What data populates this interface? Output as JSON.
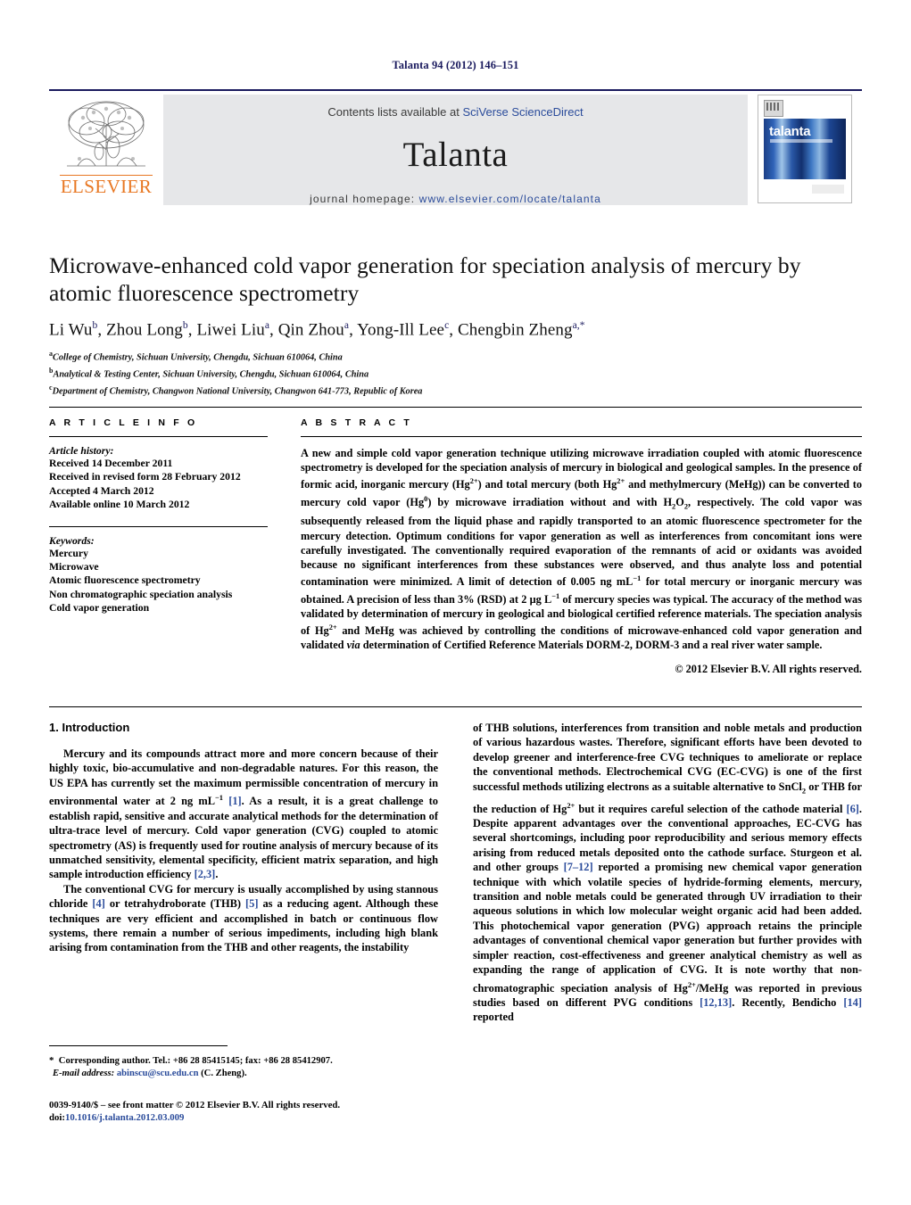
{
  "running_head": "Talanta 94 (2012) 146–151",
  "masthead": {
    "contents_prefix": "Contents lists available at ",
    "contents_link": "SciVerse ScienceDirect",
    "journal_name": "Talanta",
    "homepage_prefix": "journal homepage: ",
    "homepage_url": "www.elsevier.com/locate/talanta",
    "publisher_wordmark": "ELSEVIER",
    "cover_title": "talanta",
    "link_color": "#2b4c9b",
    "brand_orange": "#E87722",
    "band_color": "#e6e7e9"
  },
  "article": {
    "title": "Microwave-enhanced cold vapor generation for speciation analysis of mercury by atomic fluorescence spectrometry",
    "authors_html": "Li Wu<sup>b</sup>, Zhou Long<sup>b</sup>, Liwei Liu<sup>a</sup>, Qin Zhou<sup>a</sup>, Yong-Ill Lee<sup>c</sup>, Chengbin Zheng<sup>a,</sup><sup>*</sup>",
    "affiliations": [
      {
        "marker": "a",
        "text": "College of Chemistry, Sichuan University, Chengdu, Sichuan 610064, China"
      },
      {
        "marker": "b",
        "text": "Analytical & Testing Center, Sichuan University, Chengdu, Sichuan 610064, China"
      },
      {
        "marker": "c",
        "text": "Department of Chemistry, Changwon National University, Changwon 641-773, Republic of Korea"
      }
    ]
  },
  "article_info": {
    "label": "A R T I C L E    I N F O",
    "history_heading": "Article history:",
    "history": [
      "Received 14 December 2011",
      "Received in revised form 28 February 2012",
      "Accepted 4 March 2012",
      "Available online 10 March 2012"
    ],
    "keywords_heading": "Keywords:",
    "keywords": [
      "Mercury",
      "Microwave",
      "Atomic fluorescence spectrometry",
      "Non chromatographic speciation analysis",
      "Cold vapor generation"
    ]
  },
  "abstract": {
    "label": "A B S T R A C T",
    "text_html": "A new and simple cold vapor generation technique utilizing microwave irradiation coupled with atomic fluorescence spectrometry is developed for the speciation analysis of mercury in biological and geological samples. In the presence of formic acid, inorganic mercury (Hg<sup class=\"ss\">2+</sup>) and total mercury (both Hg<sup class=\"ss\">2+</sup> and methylmercury (MeHg)) can be converted to mercury cold vapor (Hg<sup class=\"ss\">0</sup>) by microwave irradiation without and with H<sub class=\"ss\">2</sub>O<sub class=\"ss\">2</sub>, respectively. The cold vapor was subsequently released from the liquid phase and rapidly transported to an atomic fluorescence spectrometer for the mercury detection. Optimum conditions for vapor generation as well as interferences from concomitant ions were carefully investigated. The conventionally required evaporation of the remnants of acid or oxidants was avoided because no significant interferences from these substances were observed, and thus analyte loss and potential contamination were minimized. A limit of detection of 0.005 ng mL<sup class=\"ss\">−1</sup> for total mercury or inorganic mercury was obtained. A precision of less than 3% (RSD) at 2 &mu;g L<sup class=\"ss\">−1</sup> of mercury species was typical. The accuracy of the method was validated by determination of mercury in geological and biological certified reference materials. The speciation analysis of Hg<sup class=\"ss\">2+</sup> and MeHg was achieved by controlling the conditions of microwave-enhanced cold vapor generation and validated <i>via</i> determination of Certified Reference Materials DORM-2, DORM-3 and a real river water sample.",
    "copyright": "© 2012 Elsevier B.V. All rights reserved."
  },
  "body": {
    "section_title": "1.  Introduction",
    "left_paragraphs_html": [
      "Mercury and its compounds attract more and more concern because of their highly toxic, bio-accumulative and non-degradable natures. For this reason, the US EPA has currently set the maximum permissible concentration of mercury in environmental water at 2 ng mL<sup class=\"ss\">−1</sup> <span class=\"cite\">[1]</span>. As a result, it is a great challenge to establish rapid, sensitive and accurate analytical methods for the determination of ultra-trace level of mercury. Cold vapor generation (CVG) coupled to atomic spectrometry (AS) is frequently used for routine analysis of mercury because of its unmatched sensitivity, elemental specificity, efficient matrix separation, and high sample introduction efficiency <span class=\"cite\">[2,3]</span>.",
      "The conventional CVG for mercury is usually accomplished by using stannous chloride <span class=\"cite\">[4]</span> or tetrahydroborate (THB) <span class=\"cite\">[5]</span> as a reducing agent. Although these techniques are very efficient and accomplished in batch or continuous flow systems, there remain a number of serious impediments, including high blank arising from contamination from the THB and other reagents, the instability"
    ],
    "right_paragraphs_html": [
      "of THB solutions, interferences from transition and noble metals and production of various hazardous wastes. Therefore, significant efforts have been devoted to develop greener and interference-free CVG techniques to ameliorate or replace the conventional methods. Electrochemical CVG (EC-CVG) is one of the first successful methods utilizing electrons as a suitable alternative to SnCl<sub class=\"ss\">2</sub> or THB for the reduction of Hg<sup class=\"ss\">2+</sup> but it requires careful selection of the cathode material <span class=\"cite\">[6]</span>. Despite apparent advantages over the conventional approaches, EC-CVG has several shortcomings, including poor reproducibility and serious memory effects arising from reduced metals deposited onto the cathode surface. Sturgeon et al. and other groups <span class=\"cite\">[7–12]</span> reported a promising new chemical vapor generation technique with which volatile species of hydride-forming elements, mercury, transition and noble metals could be generated through UV irradiation to their aqueous solutions in which low molecular weight organic acid had been added. This photochemical vapor generation (PVG) approach retains the principle advantages of conventional chemical vapor generation but further provides with simpler reaction, cost-effectiveness and greener analytical chemistry as well as expanding the range of application of CVG. It is note worthy that non-chromatographic speciation analysis of Hg<sup class=\"ss\">2+</sup>/MeHg was reported in previous studies based on different PVG conditions <span class=\"cite\">[12,13]</span>. Recently, Bendicho <span class=\"cite\">[14]</span> reported"
    ]
  },
  "footnotes": {
    "corresponding_html": "<span class=\"star\">*</span>&nbsp; Corresponding author. Tel.: +86 28 85415145; fax: +86 28 85412907.",
    "email_label": "E-mail address:",
    "email": "abinscu@scu.edu.cn",
    "email_owner": "(C. Zheng).",
    "issn_line": "0039-9140/$ – see front matter © 2012 Elsevier B.V. All rights reserved.",
    "doi_prefix": "doi:",
    "doi": "10.1016/j.talanta.2012.03.009"
  }
}
